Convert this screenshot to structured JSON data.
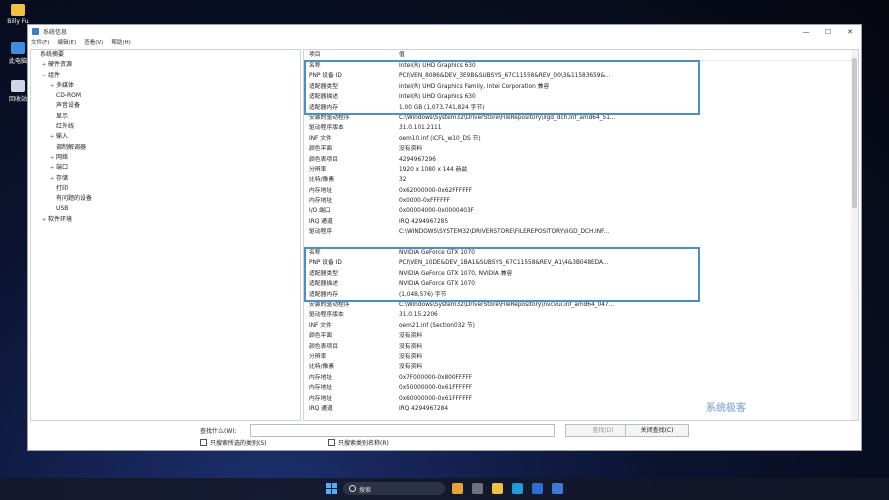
{
  "desktop": {
    "user_folder": "Billy Fu",
    "this_pc": "此电脑",
    "recycle_bin": "回收站"
  },
  "window": {
    "title": "系统信息",
    "controls": {
      "minimize": "—",
      "maximize": "☐",
      "close": "✕"
    }
  },
  "menu": [
    "文件(F)",
    "编辑(E)",
    "查看(V)",
    "帮助(H)"
  ],
  "tree": [
    {
      "label": "系统摘要",
      "level": 0,
      "toggle": ""
    },
    {
      "label": "硬件资源",
      "level": 1,
      "toggle": "+"
    },
    {
      "label": "组件",
      "level": 1,
      "toggle": "−"
    },
    {
      "label": "多媒体",
      "level": 2,
      "toggle": "+"
    },
    {
      "label": "CD-ROM",
      "level": 2,
      "toggle": ""
    },
    {
      "label": "声音设备",
      "level": 2,
      "toggle": ""
    },
    {
      "label": "显示",
      "level": 2,
      "toggle": ""
    },
    {
      "label": "红外线",
      "level": 2,
      "toggle": ""
    },
    {
      "label": "输入",
      "level": 2,
      "toggle": "+"
    },
    {
      "label": "调制解调器",
      "level": 2,
      "toggle": ""
    },
    {
      "label": "网络",
      "level": 2,
      "toggle": "+"
    },
    {
      "label": "端口",
      "level": 2,
      "toggle": "+"
    },
    {
      "label": "存储",
      "level": 2,
      "toggle": "+"
    },
    {
      "label": "打印",
      "level": 2,
      "toggle": ""
    },
    {
      "label": "有问题的设备",
      "level": 2,
      "toggle": ""
    },
    {
      "label": "USB",
      "level": 2,
      "toggle": ""
    },
    {
      "label": "软件环境",
      "level": 1,
      "toggle": "+"
    }
  ],
  "details": {
    "headers": [
      "项目",
      "值"
    ],
    "rows": [
      [
        "名称",
        "Intel(R) UHD Graphics 630"
      ],
      [
        "PNP 设备 ID",
        "PCI\\VEN_8086&DEV_3E9B&SUBSYS_67C11558&REV_00\\3&11583659&..."
      ],
      [
        "适配器类型",
        "Intel(R) UHD Graphics Family, Intel Corporation 兼容"
      ],
      [
        "适配器描述",
        "Intel(R) UHD Graphics 630"
      ],
      [
        "适配器内存",
        "1.00 GB (1,073,741,824 字节)"
      ],
      [
        "安装的驱动程序",
        "C:\\Windows\\System32\\DriverStore\\FileRepository\\iigd_dch.inf_amd64_51..."
      ],
      [
        "驱动程序版本",
        "31.0.101.2111"
      ],
      [
        "INF 文件",
        "oem10.inf (iCFL_w10_DS 节)"
      ],
      [
        "颜色平面",
        "没有资料"
      ],
      [
        "颜色表项目",
        "4294967296"
      ],
      [
        "分辨率",
        "1920 x 1080 x 144 赫兹"
      ],
      [
        "比特/像素",
        "32"
      ],
      [
        "内存地址",
        "0x62000000-0x62FFFFFF"
      ],
      [
        "内存地址",
        "0x0000-0xFFFFFF"
      ],
      [
        "I/O 端口",
        "0x00004000-0x0000403F"
      ],
      [
        "IRQ 通道",
        "IRQ 4294967285"
      ],
      [
        "驱动程序",
        "C:\\WINDOWS\\SYSTEM32\\DRIVERSTORE\\FILEREPOSITORY\\IIGD_DCH.INF..."
      ],
      [
        "",
        ""
      ],
      [
        "名称",
        "NVIDIA GeForce GTX 1070"
      ],
      [
        "PNP 设备 ID",
        "PCI\\VEN_10DE&DEV_1BA1&SUBSYS_67C11558&REV_A1\\4&3B048EDA..."
      ],
      [
        "适配器类型",
        "NVIDIA GeForce GTX 1070, NVIDIA 兼容"
      ],
      [
        "适配器描述",
        "NVIDIA GeForce GTX 1070"
      ],
      [
        "适配器内存",
        "(1,048,576) 字节"
      ],
      [
        "安装的驱动程序",
        "C:\\Windows\\System32\\DriverStore\\FileRepository\\nvcvui.inf_amd64_047..."
      ],
      [
        "驱动程序版本",
        "31.0.15.2206"
      ],
      [
        "INF 文件",
        "oem21.inf (Section032 节)"
      ],
      [
        "颜色平面",
        "没有资料"
      ],
      [
        "颜色表项目",
        "没有资料"
      ],
      [
        "分辨率",
        "没有资料"
      ],
      [
        "比特/像素",
        "没有资料"
      ],
      [
        "内存地址",
        "0x7F000000-0x800FFFFF"
      ],
      [
        "内存地址",
        "0x50000000-0x61FFFFFF"
      ],
      [
        "内存地址",
        "0x60000000-0x61FFFFFF"
      ],
      [
        "IRQ 通道",
        "IRQ 4294967284"
      ]
    ]
  },
  "watermark": "系统极客",
  "find": {
    "label": "查找什么(W):",
    "value": "",
    "find_button": "查找(D)",
    "close_button": "关闭查找(C)",
    "option_selected": "只搜索所选的类别(S)",
    "option_names": "只搜索类别名称(R)"
  },
  "taskbar": {
    "search_placeholder": "搜索"
  }
}
